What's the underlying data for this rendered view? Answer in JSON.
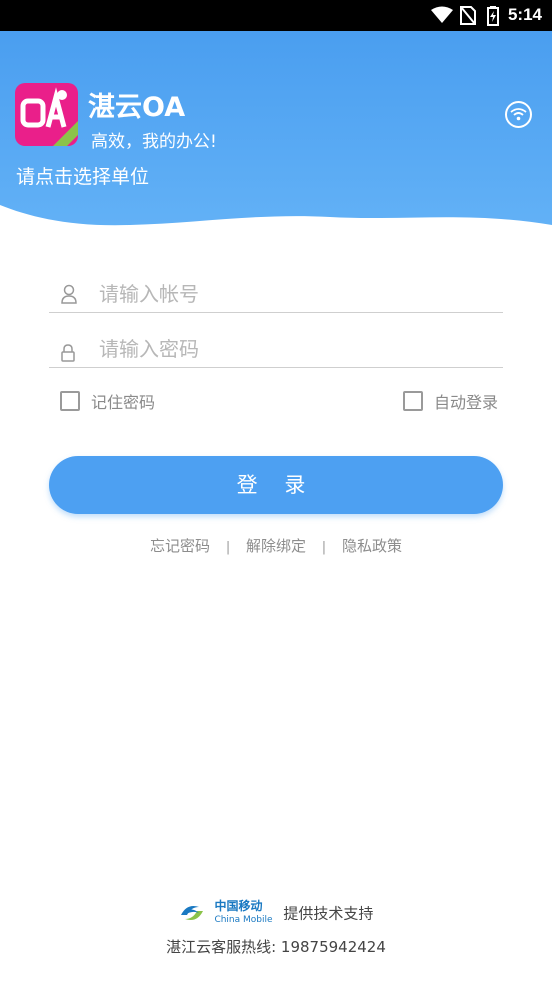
{
  "status_bar": {
    "time": "5:14",
    "icons": [
      "wifi-signal-icon",
      "no-sim-icon",
      "battery-charging-icon"
    ]
  },
  "header": {
    "app_title": "湛云OA",
    "slogan": "高效，我的办公!",
    "unit_select": "请点击选择单位",
    "logo_text": "OA"
  },
  "form": {
    "account_placeholder": "请输入帐号",
    "password_placeholder": "请输入密码",
    "remember_password": "记住密码",
    "auto_login": "自动登录",
    "login_button": "登 录"
  },
  "links": {
    "forgot_password": "忘记密码",
    "unbind": "解除绑定",
    "privacy_policy": "隐私政策",
    "separator": "|"
  },
  "footer": {
    "provider_zh": "中国移动",
    "provider_en": "China Mobile",
    "support": "提供技术支持",
    "hotline": "湛江云客服热线: 19875942424"
  },
  "colors": {
    "header_gradient_top": "#4da0f2",
    "header_gradient_bottom": "#5fb0f5",
    "button": "#4da0f2",
    "logo_pink": "#ea1f8a"
  }
}
